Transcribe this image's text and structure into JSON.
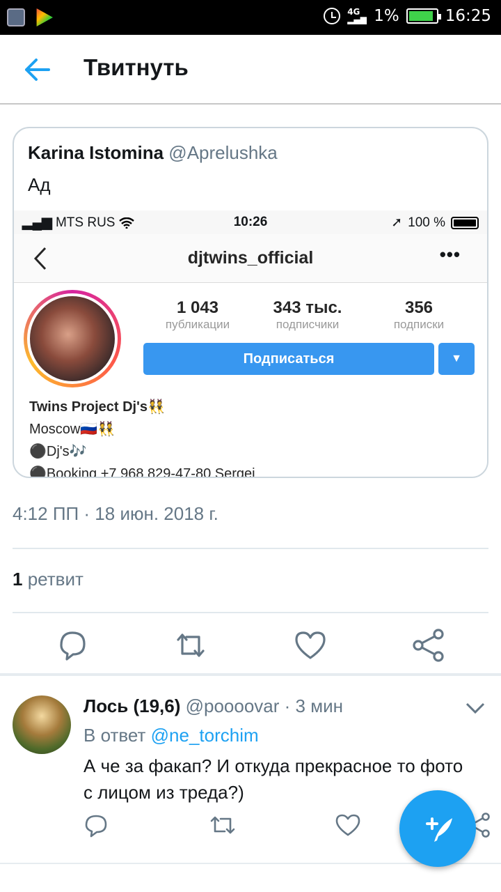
{
  "statusbar": {
    "battery_pct": "1%",
    "time": "16:25",
    "network": "4G",
    "battery_level": 0.9
  },
  "header": {
    "title": "Твитнуть"
  },
  "quoted_tweet": {
    "name": "Karina Istomina",
    "handle": "@Aprelushka",
    "text": "Ад",
    "image": {
      "ios_carrier": "MTS RUS",
      "ios_time": "10:26",
      "ios_battery": "100 %",
      "username": "djtwins_official",
      "more": "•••",
      "stats": [
        {
          "num": "1 043",
          "label": "публикации"
        },
        {
          "num": "343 тыс.",
          "label": "подписчики"
        },
        {
          "num": "356",
          "label": "подписки"
        }
      ],
      "follow_label": "Подписаться",
      "dropdown": "▼",
      "bio": {
        "name": "Twins Project Dj's👯",
        "line2": "Moscow🇷🇺👯",
        "line3": "⚫Dj's🎶",
        "line4": "⚫Booking +7 968 829-47-80 Sergei"
      }
    }
  },
  "meta": {
    "time": "4:12 ПП · 18 июн. 2018 г."
  },
  "retweets": {
    "count": "1",
    "label": "ретвит"
  },
  "reply": {
    "name": "Лось (19,6)",
    "handle": "@poooovar",
    "time": "· 3 мин",
    "reply_prefix": "В ответ",
    "reply_to": "@ne_torchim",
    "text": "А че за факап? И откуда прекрасное то фото с лицом из треда?)"
  },
  "icons": {
    "back": "arrow-left-icon",
    "reply": "comment-icon",
    "retweet": "retweet-icon",
    "like": "heart-icon",
    "share": "share-icon",
    "compose": "compose-feather-icon"
  },
  "colors": {
    "accent": "#1da1f2",
    "ig_blue": "#3897f0",
    "gray_text": "#657786"
  }
}
